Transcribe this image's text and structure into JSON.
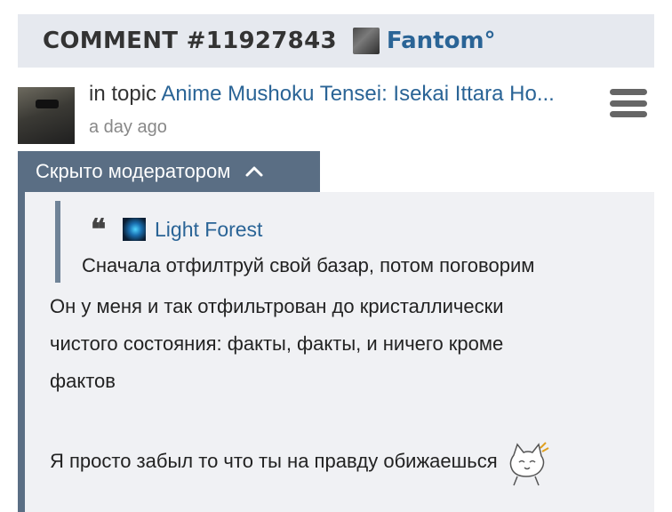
{
  "header": {
    "title": "COMMENT #11927843",
    "username": "Fantom°"
  },
  "meta": {
    "in_topic_prefix": "in topic",
    "topic_title": "Anime Mushoku Tensei: Isekai Ittara Ho...",
    "time": "a day ago"
  },
  "moderation": {
    "label": "Скрыто модератором"
  },
  "quote": {
    "author": "Light Forest",
    "text": "Сначала отфилтруй свой базар, потом поговорим"
  },
  "body": {
    "line1": "Он у меня и так отфильтрован до кристаллически",
    "line2": "чистого состояния: факты, факты, и ничего кроме",
    "line3": "фактов",
    "line4": "Я просто забыл то что ты на правду обижаешься"
  },
  "colors": {
    "header_bg": "#e6e9ef",
    "link": "#2a6496",
    "moderation_bg": "#5a6e84",
    "content_bg": "#f0f1f4"
  },
  "icons": {
    "menu": "hamburger-icon",
    "collapse": "chevron-up-icon",
    "quote": "quote-icon",
    "sticker": "cat-sticker-icon"
  }
}
